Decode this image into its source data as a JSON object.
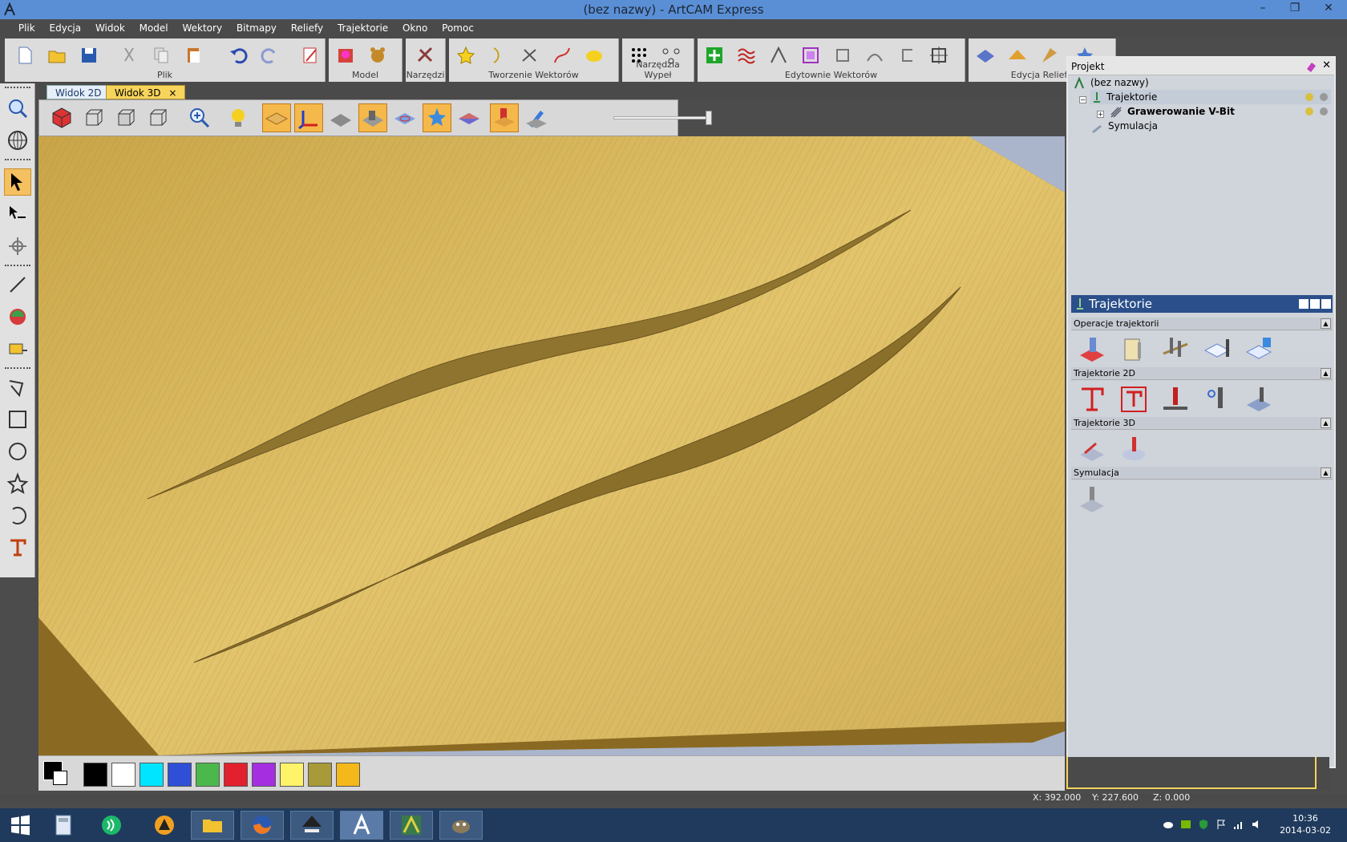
{
  "window": {
    "title": "(bez nazwy) - ArtCAM Express",
    "minimize": "–",
    "restore": "❐",
    "close": "✕"
  },
  "menu": [
    "Plik",
    "Edycja",
    "Widok",
    "Model",
    "Wektory",
    "Bitmapy",
    "Reliefy",
    "Trajektorie",
    "Okno",
    "Pomoc"
  ],
  "toolbar_groups": [
    {
      "label": "Plik"
    },
    {
      "label": "Model"
    },
    {
      "label": "Narzędzi"
    },
    {
      "label": "Tworzenie Wektorów"
    },
    {
      "label": "Narzędzia Wypeł"
    },
    {
      "label": "Edytownie Wektorów"
    },
    {
      "label": "Edycja Reliefu"
    }
  ],
  "view_tabs": [
    {
      "label": "Widok 2D",
      "active": false
    },
    {
      "label": "Widok 3D",
      "active": true
    }
  ],
  "tab_close": "×",
  "project_panel": {
    "title": "Projekt",
    "tree": [
      {
        "label": "(bez nazwy)"
      },
      {
        "label": "Trajektorie"
      },
      {
        "label": "Grawerowanie V-Bit"
      },
      {
        "label": "Symulacja"
      }
    ]
  },
  "toolpath_panel": {
    "title": "Trajektorie",
    "sections": [
      {
        "label": "Operacje trajektorii"
      },
      {
        "label": "Trajektorie 2D"
      },
      {
        "label": "Trajektorie 3D"
      },
      {
        "label": "Symulacja"
      }
    ]
  },
  "palette": [
    "#000000",
    "#ffffff",
    "#00e5ff",
    "#2f4fd6",
    "#4cb84c",
    "#e2202e",
    "#a42ee0",
    "#fff36a",
    "#a89a38",
    "#f5b81a"
  ],
  "status": {
    "x": "X: 392.000",
    "y": "Y: 227.600",
    "z": "Z: 0.000"
  },
  "clock": {
    "time": "10:36",
    "date": "2014-03-02"
  },
  "colors": {
    "wood": "#d7b456",
    "accent": "#f7d45c",
    "panel_header": "#2a4f8a"
  }
}
